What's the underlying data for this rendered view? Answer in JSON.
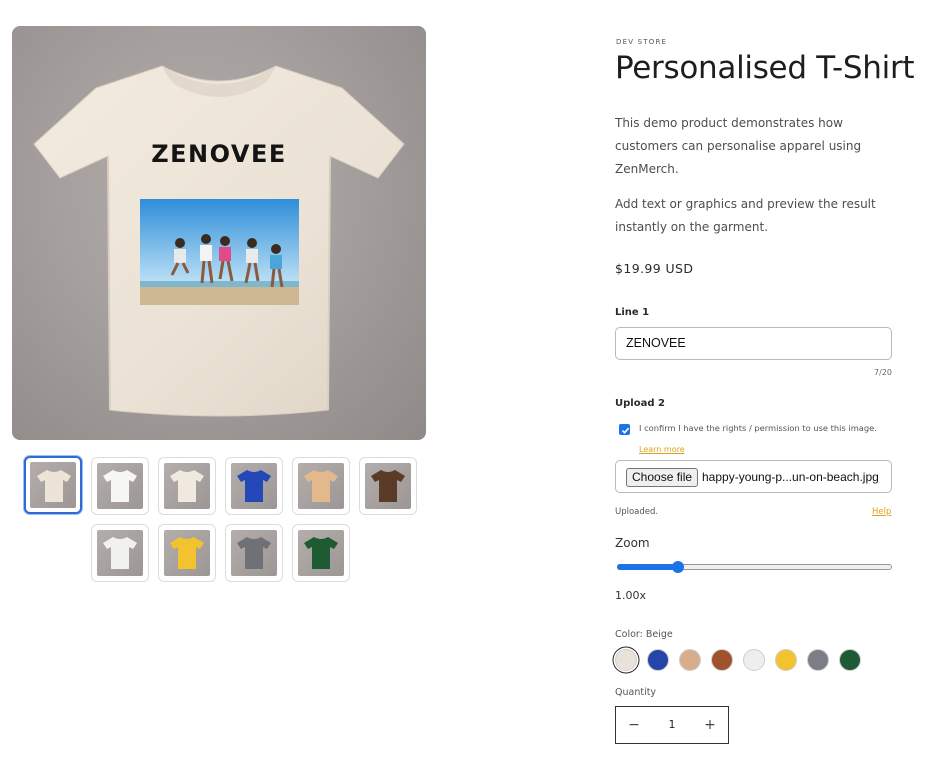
{
  "gallery": {
    "main_image": {
      "alt": "T-shirt preview",
      "shirt_color": "#ece3d6",
      "print_text": "ZENOVEE"
    },
    "thumbnails": [
      {
        "color": "#ede4d7",
        "active": true
      },
      {
        "color": "#f6f6f4",
        "active": false
      },
      {
        "color": "#efe9df",
        "active": false
      },
      {
        "color": "#2548b8",
        "active": false
      },
      {
        "color": "#e2b88c",
        "active": false
      },
      {
        "color": "#5a3b27",
        "active": false
      },
      {
        "color": "#f1f1ef",
        "active": false
      },
      {
        "color": "#f3c22f",
        "active": false
      },
      {
        "color": "#6f7177",
        "active": false
      },
      {
        "color": "#1e5b33",
        "active": false
      }
    ]
  },
  "product": {
    "vendor": "DEV STORE",
    "title": "Personalised T-Shirt",
    "description_1": "This demo product demonstrates how customers can personalise apparel using ZenMerch.",
    "description_2": "Add text or graphics and preview the result instantly on the garment.",
    "price": "$19.99 USD"
  },
  "personalisation": {
    "line1_label": "Line 1",
    "line1_value": "ZENOVEE",
    "line1_counter": "7/20",
    "upload_label": "Upload 2",
    "confirm_text": "I confirm I have the rights / permission to use this image.",
    "confirm_checked": true,
    "learn_more": "Learn more",
    "choose_file": "Choose file",
    "file_name": "happy-young-p...un-on-beach.jpg",
    "status": "Uploaded.",
    "help": "Help",
    "zoom_label": "Zoom",
    "zoom_value": "1.00x",
    "zoom_fraction": 0.22
  },
  "variant": {
    "color_label": "Color: Beige",
    "swatches": [
      {
        "name": "Beige",
        "color": "#e9e2d8",
        "selected": true
      },
      {
        "name": "Royal Blue",
        "color": "#2346a8",
        "selected": false
      },
      {
        "name": "Tan",
        "color": "#d8ad8c",
        "selected": false
      },
      {
        "name": "Brown",
        "color": "#a0522d",
        "selected": false
      },
      {
        "name": "White",
        "color": "#eeeeee",
        "selected": false
      },
      {
        "name": "Yellow",
        "color": "#f3c22f",
        "selected": false
      },
      {
        "name": "Grey",
        "color": "#7b7e86",
        "selected": false
      },
      {
        "name": "Green",
        "color": "#1f5a36",
        "selected": false
      }
    ]
  },
  "quantity": {
    "label": "Quantity",
    "value": "1",
    "minus": "−",
    "plus": "+"
  }
}
